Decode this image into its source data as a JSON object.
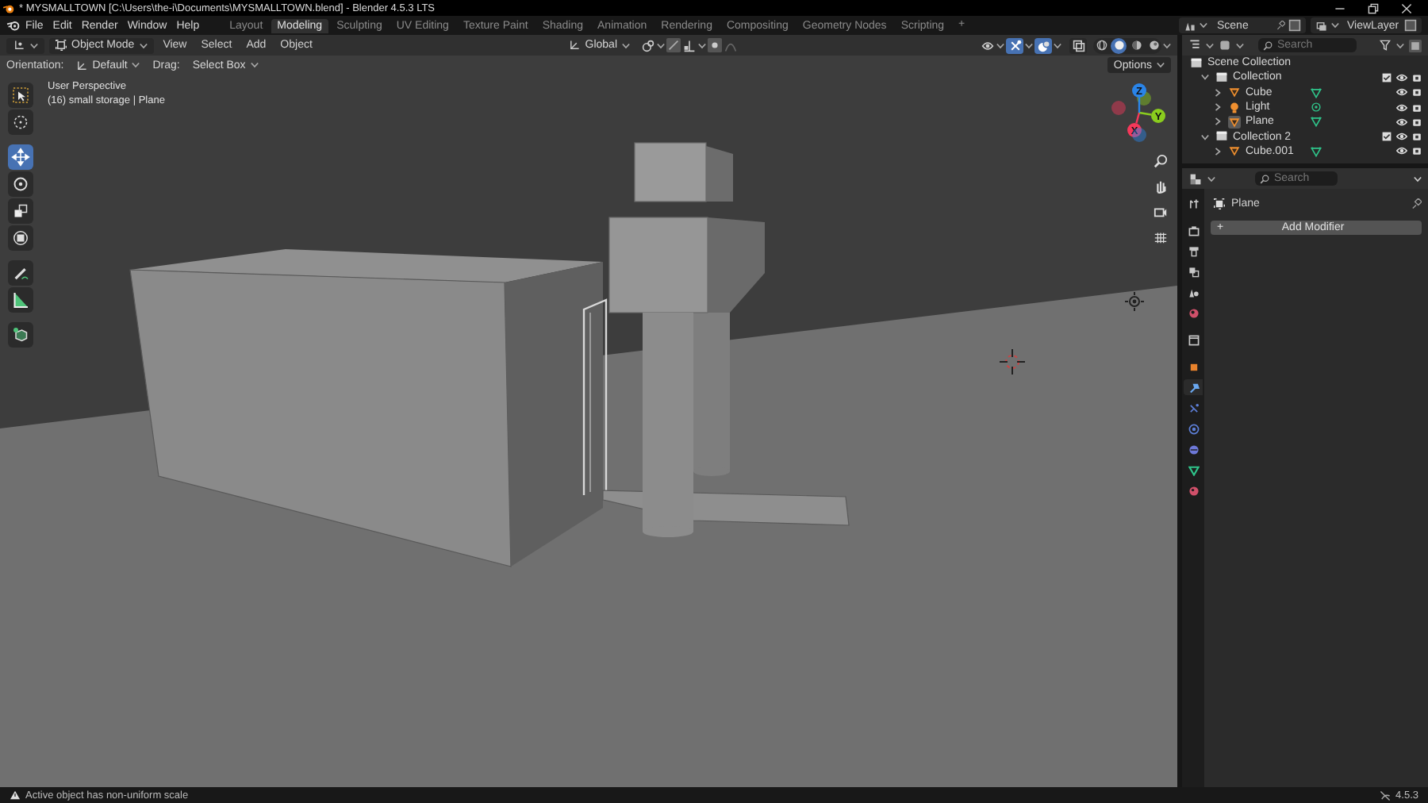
{
  "window": {
    "title": "* MYSMALLTOWN [C:\\Users\\the-i\\Documents\\MYSMALLTOWN.blend] - Blender 4.5.3 LTS"
  },
  "menu": [
    "File",
    "Edit",
    "Render",
    "Window",
    "Help"
  ],
  "workspaces": [
    {
      "label": "Layout",
      "selected": false
    },
    {
      "label": "Modeling",
      "selected": true
    },
    {
      "label": "Sculpting",
      "selected": false
    },
    {
      "label": "UV Editing",
      "selected": false
    },
    {
      "label": "Texture Paint",
      "selected": false
    },
    {
      "label": "Shading",
      "selected": false
    },
    {
      "label": "Animation",
      "selected": false
    },
    {
      "label": "Rendering",
      "selected": false
    },
    {
      "label": "Compositing",
      "selected": false
    },
    {
      "label": "Geometry Nodes",
      "selected": false
    },
    {
      "label": "Scripting",
      "selected": false
    }
  ],
  "add_workspace": "+",
  "scene": {
    "name": "Scene",
    "view_layer": "ViewLayer"
  },
  "viewport": {
    "mode": "Object Mode",
    "menus": [
      "View",
      "Select",
      "Add",
      "Object"
    ],
    "transform_orientation": "Global",
    "orientation_label": "Orientation:",
    "orientation": "Default",
    "drag_label": "Drag:",
    "drag": "Select Box",
    "options": "Options",
    "gizmos": {
      "on": true
    },
    "overlays": {
      "on": true
    },
    "xray": {
      "on": false
    },
    "shading_modes": [
      {
        "kind": "wireframe",
        "selected": false
      },
      {
        "kind": "solid",
        "selected": true
      },
      {
        "kind": "material",
        "selected": false
      },
      {
        "kind": "rendered",
        "selected": false
      }
    ],
    "info": [
      "User Perspective",
      "(16) small storage | Plane"
    ],
    "tools": [
      {
        "kind": "select",
        "selected": false
      },
      {
        "kind": "cursor",
        "selected": false
      },
      {
        "kind": "move",
        "selected": true
      },
      {
        "kind": "rotate",
        "selected": false
      },
      {
        "kind": "scale",
        "selected": false
      },
      {
        "kind": "transform",
        "selected": false
      },
      {
        "kind": "annotate",
        "selected": false
      },
      {
        "kind": "measure",
        "selected": false
      },
      {
        "kind": "add-cube",
        "selected": false
      }
    ],
    "axes": [
      "X",
      "Y",
      "Z"
    ]
  },
  "outliner": {
    "search": {
      "placeholder": "Search"
    },
    "tree": [
      {
        "name": "Scene Collection",
        "kind": "scene",
        "children": [
          {
            "name": "Collection",
            "kind": "collection",
            "expanded": true,
            "children": [
              {
                "name": "Cube",
                "kind": "mesh",
                "expanded": false,
                "selected": false
              },
              {
                "name": "Light",
                "kind": "light",
                "expanded": false,
                "selected": false
              },
              {
                "name": "Plane",
                "kind": "mesh",
                "expanded": false,
                "selected": true
              }
            ]
          },
          {
            "name": "Collection 2",
            "kind": "collection",
            "expanded": true,
            "children": [
              {
                "name": "Cube.001",
                "kind": "mesh",
                "expanded": false,
                "selected": false
              }
            ]
          }
        ]
      }
    ]
  },
  "properties": {
    "search": {
      "placeholder": "Search"
    },
    "object": "Plane",
    "add_icon": "+",
    "add_modifier": "Add Modifier",
    "tabs": [
      {
        "kind": "tool",
        "color": "#c8c8c8",
        "selected": false
      },
      {
        "kind": "render",
        "color": "#c8c8c8",
        "selected": false
      },
      {
        "kind": "output",
        "color": "#c8c8c8",
        "selected": false
      },
      {
        "kind": "view-layer",
        "color": "#c8c8c8",
        "selected": false
      },
      {
        "kind": "scene",
        "color": "#c8c8c8",
        "selected": false
      },
      {
        "kind": "world",
        "color": "#d0506a",
        "selected": false
      },
      {
        "kind": "collection",
        "color": "#c8c8c8",
        "selected": false
      },
      {
        "kind": "object",
        "color": "#e8822c",
        "selected": false
      },
      {
        "kind": "modifier",
        "color": "#6aa8f0",
        "selected": true
      },
      {
        "kind": "particles",
        "color": "#5d7fd8",
        "selected": false
      },
      {
        "kind": "physics",
        "color": "#5d7fd8",
        "selected": false
      },
      {
        "kind": "constraints",
        "color": "#6d78d8",
        "selected": false
      },
      {
        "kind": "data",
        "color": "#2fc48a",
        "selected": false
      },
      {
        "kind": "material",
        "color": "#d0506a",
        "selected": false
      }
    ]
  },
  "status_bar": {
    "message": "Active object has non-uniform scale",
    "version": "4.5.3"
  }
}
